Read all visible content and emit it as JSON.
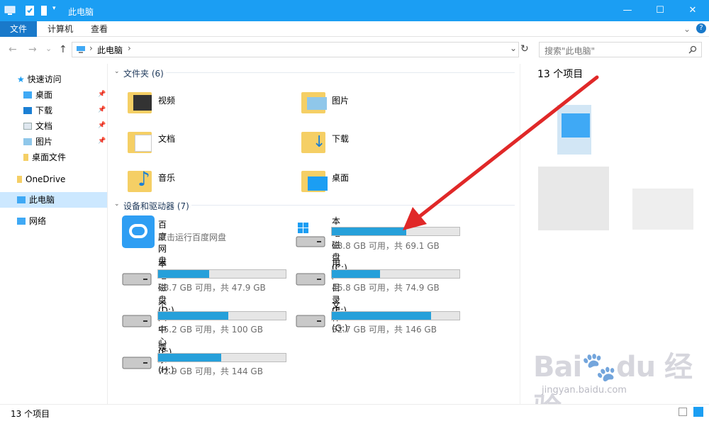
{
  "window": {
    "title": "此电脑",
    "minimize": "—",
    "maximize": "☐",
    "close": "✕"
  },
  "ribbon": {
    "tabs": [
      "文件",
      "计算机",
      "查看"
    ]
  },
  "nav": {
    "back": "←",
    "forward": "→",
    "recent": "⌄",
    "up": "↑",
    "path_sep": "›",
    "path": "此电脑",
    "dropdown": "⌄",
    "refresh": "↻"
  },
  "search": {
    "placeholder": "搜索\"此电脑\"",
    "icon": "search-icon"
  },
  "sidebar": {
    "quick_access": "快速访问",
    "items": [
      {
        "label": "桌面"
      },
      {
        "label": "下载"
      },
      {
        "label": "文档"
      },
      {
        "label": "图片"
      },
      {
        "label": "桌面文件"
      }
    ],
    "onedrive": "OneDrive",
    "this_pc": "此电脑",
    "network": "网络"
  },
  "folders": {
    "header": "文件夹 (6)",
    "items": [
      "视频",
      "图片",
      "文档",
      "下载",
      "音乐",
      "桌面"
    ]
  },
  "devices": {
    "header": "设备和驱动器 (7)",
    "baidu": {
      "name": "百度网盘",
      "desc": "双击运行百度网盘"
    },
    "drives": [
      {
        "name": "本地磁盘 (C:)",
        "info": "28.8 GB 可用，共 69.1 GB",
        "used": 0.583
      },
      {
        "name": "本地磁盘 (D:)",
        "info": "28.7 GB 可用，共 47.9 GB",
        "used": 0.401
      },
      {
        "name": "用户目录 (E:)",
        "info": "46.8 GB 可用，共 74.9 GB",
        "used": 0.375
      },
      {
        "name": "个人中心 (F:)",
        "info": "45.2 GB 可用，共 100 GB",
        "used": 0.548
      },
      {
        "name": "文件 (G:)",
        "info": "32.7 GB 可用，共 146 GB",
        "used": 0.776
      },
      {
        "name": "娱乐 (H:)",
        "info": "72.9 GB 可用，共 144 GB",
        "used": 0.494
      }
    ]
  },
  "details": {
    "count": "13 个项目"
  },
  "status": {
    "count": "13 个项目"
  },
  "colors": {
    "title": "#1b9ef3",
    "accent": "#26a0da",
    "annotation_arrow": "#e02828"
  }
}
